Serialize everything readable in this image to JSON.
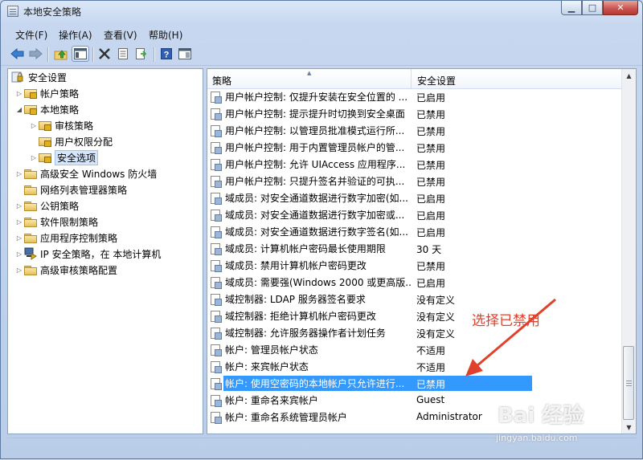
{
  "window": {
    "title": "本地安全策略"
  },
  "menu": {
    "file": "文件(F)",
    "action": "操作(A)",
    "view": "查看(V)",
    "help": "帮助(H)"
  },
  "toolbar_icons": [
    "back-icon",
    "forward-icon",
    "up-folder-icon",
    "show-hide-tree-icon",
    "delete-icon",
    "properties-icon",
    "export-list-icon",
    "help-icon",
    "show-pane-icon"
  ],
  "tree": {
    "root": "安全设置",
    "items": [
      {
        "label": "帐户策略"
      },
      {
        "label": "本地策略"
      },
      {
        "label": "审核策略"
      },
      {
        "label": "用户权限分配"
      },
      {
        "label": "安全选项"
      },
      {
        "label": "高级安全 Windows 防火墙"
      },
      {
        "label": "网络列表管理器策略"
      },
      {
        "label": "公钥策略"
      },
      {
        "label": "软件限制策略"
      },
      {
        "label": "应用程序控制策略"
      },
      {
        "label": "IP 安全策略，在 本地计算机"
      },
      {
        "label": "高级审核策略配置"
      }
    ]
  },
  "list": {
    "col_policy": "策略",
    "col_setting": "安全设置",
    "rows": [
      {
        "policy": "用户帐户控制: 仅提升安装在安全位置的 ...",
        "setting": "已启用"
      },
      {
        "policy": "用户帐户控制: 提示提升时切换到安全桌面",
        "setting": "已禁用"
      },
      {
        "policy": "用户帐户控制: 以管理员批准模式运行所...",
        "setting": "已禁用"
      },
      {
        "policy": "用户帐户控制: 用于内置管理员帐户的管...",
        "setting": "已禁用"
      },
      {
        "policy": "用户帐户控制: 允许 UIAccess 应用程序...",
        "setting": "已禁用"
      },
      {
        "policy": "用户帐户控制: 只提升签名并验证的可执...",
        "setting": "已禁用"
      },
      {
        "policy": "域成员: 对安全通道数据进行数字加密(如...",
        "setting": "已启用"
      },
      {
        "policy": "域成员: 对安全通道数据进行数字加密或...",
        "setting": "已启用"
      },
      {
        "policy": "域成员: 对安全通道数据进行数字签名(如...",
        "setting": "已启用"
      },
      {
        "policy": "域成员: 计算机帐户密码最长使用期限",
        "setting": "30 天"
      },
      {
        "policy": "域成员: 禁用计算机帐户密码更改",
        "setting": "已禁用"
      },
      {
        "policy": "域成员: 需要强(Windows 2000 或更高版...",
        "setting": "已启用"
      },
      {
        "policy": "域控制器: LDAP 服务器签名要求",
        "setting": "没有定义"
      },
      {
        "policy": "域控制器: 拒绝计算机帐户密码更改",
        "setting": "没有定义"
      },
      {
        "policy": "域控制器: 允许服务器操作者计划任务",
        "setting": "没有定义"
      },
      {
        "policy": "帐户: 管理员帐户状态",
        "setting": "不适用"
      },
      {
        "policy": "帐户: 来宾帐户状态",
        "setting": "不适用"
      },
      {
        "policy": "帐户: 使用空密码的本地帐户只允许进行...",
        "setting": "已禁用"
      },
      {
        "policy": "帐户: 重命名来宾帐户",
        "setting": "Guest"
      },
      {
        "policy": "帐户: 重命名系统管理员帐户",
        "setting": "Administrator"
      }
    ]
  },
  "annotation": "选择已禁用",
  "watermark": {
    "brand": "Bai 经验",
    "url": "jingyan.baidu.com"
  },
  "colors": {
    "selection": "#3399ff",
    "annotation": "#e0402c"
  }
}
